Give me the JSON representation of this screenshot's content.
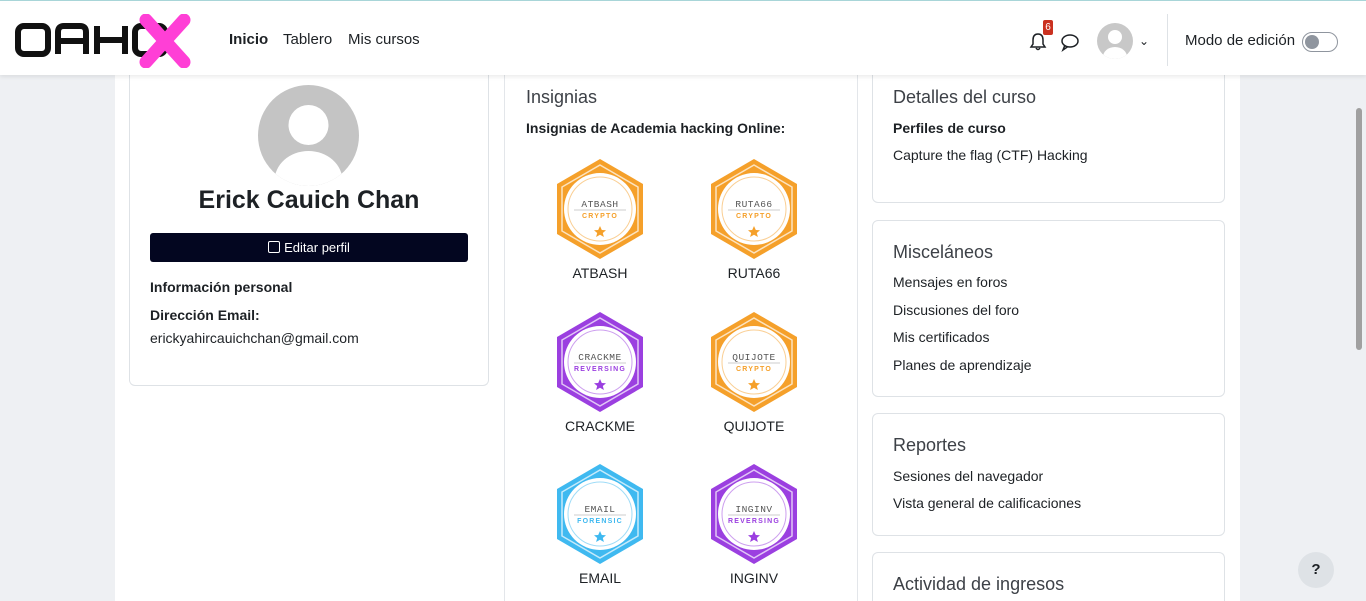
{
  "nav": {
    "logo_text": "AHOX",
    "links": [
      "Inicio",
      "Tablero",
      "Mis cursos"
    ],
    "notification_count": "6",
    "edit_mode_label": "Modo de edición",
    "edit_mode_on": false
  },
  "profile": {
    "name": "Erick Cauich Chan",
    "edit_button": "Editar perfil",
    "personal_info_label": "Información personal",
    "email_label": "Dirección Email:",
    "email": "erickyahircauichchan@gmail.com"
  },
  "badges": {
    "title": "Insignias",
    "subtitle": "Insignias de Academia hacking Online:",
    "items": [
      {
        "name": "ATBASH",
        "inner_text": "ATBASH",
        "category": "CRYPTO",
        "color": "#f5a02a"
      },
      {
        "name": "RUTA66",
        "inner_text": "RUTA66",
        "category": "CRYPTO",
        "color": "#f5a02a"
      },
      {
        "name": "CRACKME",
        "inner_text": "CRACKME",
        "category": "REVERSING",
        "color": "#9b3fe0"
      },
      {
        "name": "QUIJOTE",
        "inner_text": "QUIJOTE",
        "category": "CRYPTO",
        "color": "#f5a02a"
      },
      {
        "name": "EMAIL",
        "inner_text": "EMAIL",
        "category": "FORENSIC",
        "color": "#3fb9f0"
      },
      {
        "name": "INGINV",
        "inner_text": "INGINV",
        "category": "REVERSING",
        "color": "#9b3fe0"
      }
    ]
  },
  "course_details": {
    "title": "Detalles del curso",
    "profiles_label": "Perfiles de curso",
    "course": "Capture the flag (CTF) Hacking"
  },
  "misc": {
    "title": "Misceláneos",
    "links": [
      "Mensajes en foros",
      "Discusiones del foro",
      "Mis certificados",
      "Planes de aprendizaje"
    ]
  },
  "reports": {
    "title": "Reportes",
    "links": [
      "Sesiones del navegador",
      "Vista general de calificaciones"
    ]
  },
  "activity": {
    "title": "Actividad de ingresos"
  },
  "help_label": "?",
  "colors": {
    "accent_pink": "#ff3fd6",
    "button_dark": "#030620",
    "badge_orange": "#f5a02a",
    "badge_purple": "#9b3fe0",
    "badge_blue": "#3fb9f0"
  }
}
